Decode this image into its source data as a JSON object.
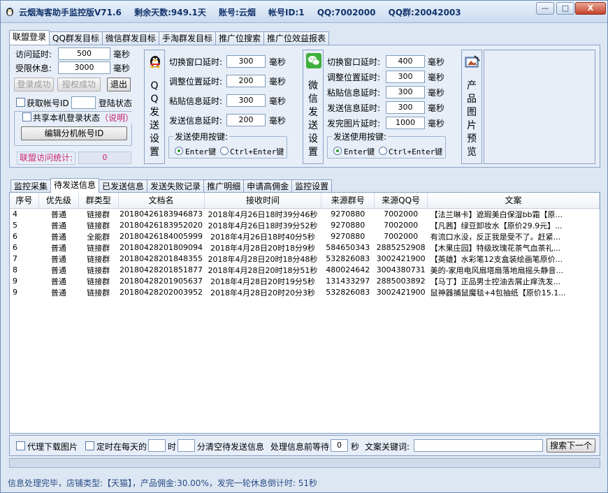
{
  "title": {
    "app": "云烟淘客助手监控版V71.6",
    "days": "剩余天数:949.1天",
    "account": "账号:云烟",
    "account_id": "帐号ID:1",
    "qq": "QQ:7002000",
    "qq_group": "QQ群:20042003"
  },
  "window_buttons": {
    "min": "—",
    "max": "□",
    "close": "X"
  },
  "top_tabs": [
    "联盟登录",
    "QQ群发目标",
    "微信群发目标",
    "手淘群发目标",
    "推广位搜索",
    "推广位效益报表"
  ],
  "login": {
    "visit_delay_label": "访问延时:",
    "visit_delay": "500",
    "visit_unit": "毫秒",
    "rest_label": "受限休息:",
    "rest": "3000",
    "rest_unit": "毫秒",
    "login_ok": "登录成功",
    "auth_ok": "授权成功",
    "exit": "退出",
    "get_id_label": "获取帐号ID",
    "get_id_value": "",
    "login_state": "登陆状态",
    "share_label": "共享本机登录状态",
    "explain": "（说明）",
    "edit_sub": "编辑分机帐号ID",
    "stats_label": "联盟访问统计:",
    "stats_value": "0"
  },
  "qq": {
    "side": [
      "Q",
      "Q",
      "发",
      "送",
      "设",
      "置"
    ],
    "rows": [
      {
        "label": "切换窗口延时:",
        "value": "300",
        "unit": "毫秒"
      },
      {
        "label": "调整位置延时:",
        "value": "200",
        "unit": "毫秒"
      },
      {
        "label": "粘贴信息延时:",
        "value": "300",
        "unit": "毫秒"
      },
      {
        "label": "发送信息延时:",
        "value": "200",
        "unit": "毫秒"
      }
    ],
    "key_title": "发送使用按键:",
    "key_enter": "Enter键",
    "key_ctrl": "Ctrl+Enter键"
  },
  "wechat": {
    "side": [
      "微",
      "信",
      "发",
      "送",
      "设",
      "置"
    ],
    "rows": [
      {
        "label": "切换窗口延时:",
        "value": "400",
        "unit": "毫秒"
      },
      {
        "label": "调整位置延时:",
        "value": "300",
        "unit": "毫秒"
      },
      {
        "label": "粘贴信息延时:",
        "value": "300",
        "unit": "毫秒"
      },
      {
        "label": "发送信息延时:",
        "value": "300",
        "unit": "毫秒"
      },
      {
        "label": "发完图片延时:",
        "value": "1000",
        "unit": "毫秒"
      }
    ],
    "key_title": "发送使用按键:",
    "key_enter": "Enter键",
    "key_ctrl": "Ctrl+Enter键"
  },
  "preview": {
    "side": [
      "产",
      "品",
      "图",
      "片",
      "预",
      "览"
    ]
  },
  "monitor_tabs": [
    "监控采集",
    "待发送信息",
    "已发送信息",
    "发送失败记录",
    "推广明细",
    "申请高佣金",
    "监控设置"
  ],
  "table": {
    "columns": [
      "序号",
      "优先级",
      "群类型",
      "文档名",
      "接收时间",
      "来源群号",
      "来源QQ号",
      "文案"
    ],
    "rows": [
      [
        "4",
        "普通",
        "链接群",
        "20180426183946873",
        "2018年4月26日18时39分46秒",
        "9270880",
        "7002000",
        "【法兰琳卡】遮瑕美白保湿bb霜【原..."
      ],
      [
        "5",
        "普通",
        "链接群",
        "20180426183952020",
        "2018年4月26日18时39分52秒",
        "9270880",
        "7002000",
        "【凡茜】绿豆卸妆水【原价29.9元】..."
      ],
      [
        "6",
        "普通",
        "全能群",
        "20180426184005999",
        "2018年4月26日18时40分5秒",
        "9270880",
        "7002000",
        "有流口水没，反正我是受不了。赶紧..."
      ],
      [
        "6",
        "普通",
        "链接群",
        "20180428201809094",
        "2018年4月28日20时18分9秒",
        "584650343",
        "2885252908",
        "【木果庄园】特级玫瑰花茶气血茶礼..."
      ],
      [
        "7",
        "普通",
        "链接群",
        "20180428201848355",
        "2018年4月28日20时18分48秒",
        "532826083",
        "3002421900",
        "【英雄】水彩笔12支盒装绘画笔原价..."
      ],
      [
        "8",
        "普通",
        "链接群",
        "20180428201851877",
        "2018年4月28日20时18分51秒",
        "480024642",
        "3004380731",
        "美的-家用电风扇塔扇落地扇摇头静音..."
      ],
      [
        "9",
        "普通",
        "链接群",
        "20180428201905637",
        "2018年4月28日20时19分5秒",
        "131433297",
        "2885003892",
        "【马丁】正品男士控油去屑止痒洗发..."
      ],
      [
        "9",
        "普通",
        "链接群",
        "20180428202003952",
        "2018年4月28日20时20分3秒",
        "532826083",
        "3002421900",
        "鼠神器捕鼠魔毯+4包抽纸【原价15.1..."
      ]
    ]
  },
  "bottom": {
    "proxy": "代理下载图片",
    "timed": "定时在每天的",
    "hour": "时",
    "clear": "分清空待发送信息",
    "wait_label": "处理信息前等待",
    "wait": "0",
    "sec": "秒",
    "kw_label": "文案关键词:",
    "kw": "",
    "search": "搜索下一个"
  },
  "status": "信息处理完毕，店铺类型:【天猫】，产品佣金:30.00%，发完一轮休息倒计时: 51秒"
}
